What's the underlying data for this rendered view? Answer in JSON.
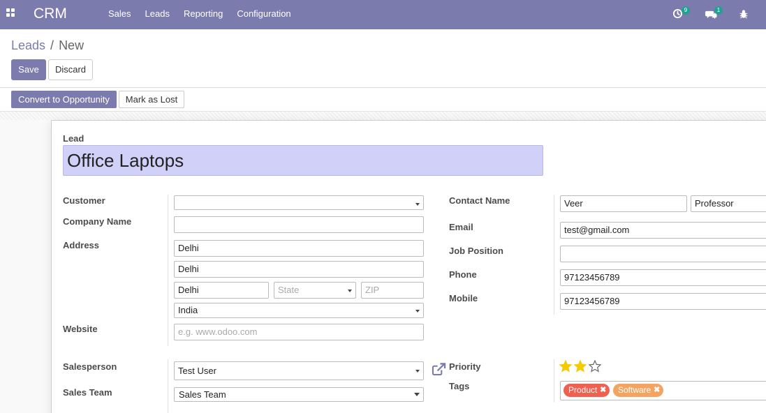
{
  "navbar": {
    "brand": "CRM",
    "menu": [
      "Sales",
      "Leads",
      "Reporting",
      "Configuration"
    ],
    "activity_count": "9",
    "message_count": "1"
  },
  "breadcrumb": {
    "parent": "Leads",
    "current": "New"
  },
  "buttons": {
    "save": "Save",
    "discard": "Discard",
    "convert": "Convert to Opportunity",
    "mark_lost": "Mark as Lost"
  },
  "form": {
    "lead_label": "Lead",
    "lead_name": "Office Laptops",
    "customer": {
      "label": "Customer",
      "value": ""
    },
    "company_name": {
      "label": "Company Name",
      "value": ""
    },
    "address": {
      "label": "Address",
      "street": "Delhi",
      "street2": "Delhi",
      "city": "Delhi",
      "state_placeholder": "State",
      "zip_placeholder": "ZIP",
      "country": "India"
    },
    "website": {
      "label": "Website",
      "placeholder": "e.g. www.odoo.com"
    },
    "contact_name": {
      "label": "Contact Name",
      "value": "Veer",
      "title": "Professor"
    },
    "email": {
      "label": "Email",
      "value": "test@gmail.com"
    },
    "job_position": {
      "label": "Job Position",
      "value": ""
    },
    "phone": {
      "label": "Phone",
      "value": "97123456789"
    },
    "mobile": {
      "label": "Mobile",
      "value": "97123456789"
    },
    "salesperson": {
      "label": "Salesperson",
      "value": "Test User"
    },
    "sales_team": {
      "label": "Sales Team",
      "value": "Sales Team"
    },
    "priority": {
      "label": "Priority",
      "stars_filled": 2,
      "stars_total": 3
    },
    "tags": {
      "label": "Tags",
      "items": [
        {
          "name": "Product",
          "color": "#f06050"
        },
        {
          "name": "Software",
          "color": "#f4a460"
        }
      ]
    }
  },
  "colors": {
    "brand": "#7c7bad",
    "title_bg": "#d1d0f9",
    "star": "#f3cc00"
  }
}
